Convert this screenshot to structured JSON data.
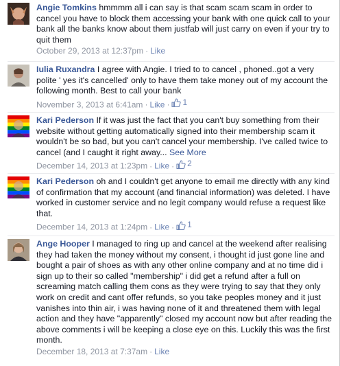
{
  "comments": [
    {
      "author": "Angie Tomkins",
      "text": "hmmmm all i can say is that scam scam scam in order to cancel you have to block them accessing your bank with one quick call to your bank all the banks know about them justfab will just carry on even if your try to quit them",
      "date": "October 29, 2013 at 12:37pm",
      "like_label": "Like",
      "like_count": ""
    },
    {
      "author": "Iulia Ruxandra",
      "text": "I agree with Angie. I tried to to cancel , phoned..got a very polite ' yes it's cancelled' only to have them take money out of my account the following month. Best to call your bank",
      "date": "November 3, 2013 at 6:41am",
      "like_label": "Like",
      "like_count": "1"
    },
    {
      "author": "Kari Pederson",
      "text": "If it was just the fact that you can't buy something from their website without getting automatically signed into their membership scam it wouldn't be so bad, but you can't cancel your membership. I've called twice to cancel (and I caught it right away...",
      "see_more": "See More",
      "date": "December 14, 2013 at 1:23pm",
      "like_label": "Like",
      "like_count": "2"
    },
    {
      "author": "Kari Pederson",
      "text": "oh and I couldn't get anyone to email me directly with any kind of confirmation that my account (and financial information) was deleted. I have worked in customer service and no legit company would refuse a request like that.",
      "date": "December 14, 2013 at 1:24pm",
      "like_label": "Like",
      "like_count": "1"
    },
    {
      "author": "Ange Hooper",
      "text": "I managed to ring up and cancel at the weekend after realising they had taken the money without my consent, i thought id just gone line and bought a pair of shoes as with any other online company and at no time did i sign up to their so called \"membership\" i did get a refund after a full on screaming match calling them cons as they were trying to say that they only work on credit and cant offer refunds, so you take peoples money and it just vanishes into thin air, i was having none of it and threatened them with legal action and they have \"apparently\" closed my account now but after reading the above comments i will be keeping a close eye on this. Luckily this was the first month.",
      "date": "December 18, 2013 at 7:37am",
      "like_label": "Like",
      "like_count": ""
    }
  ],
  "colors": {
    "link": "#3b5998",
    "meta": "#9197a3",
    "like": "#6d84b4",
    "text": "#141823"
  }
}
